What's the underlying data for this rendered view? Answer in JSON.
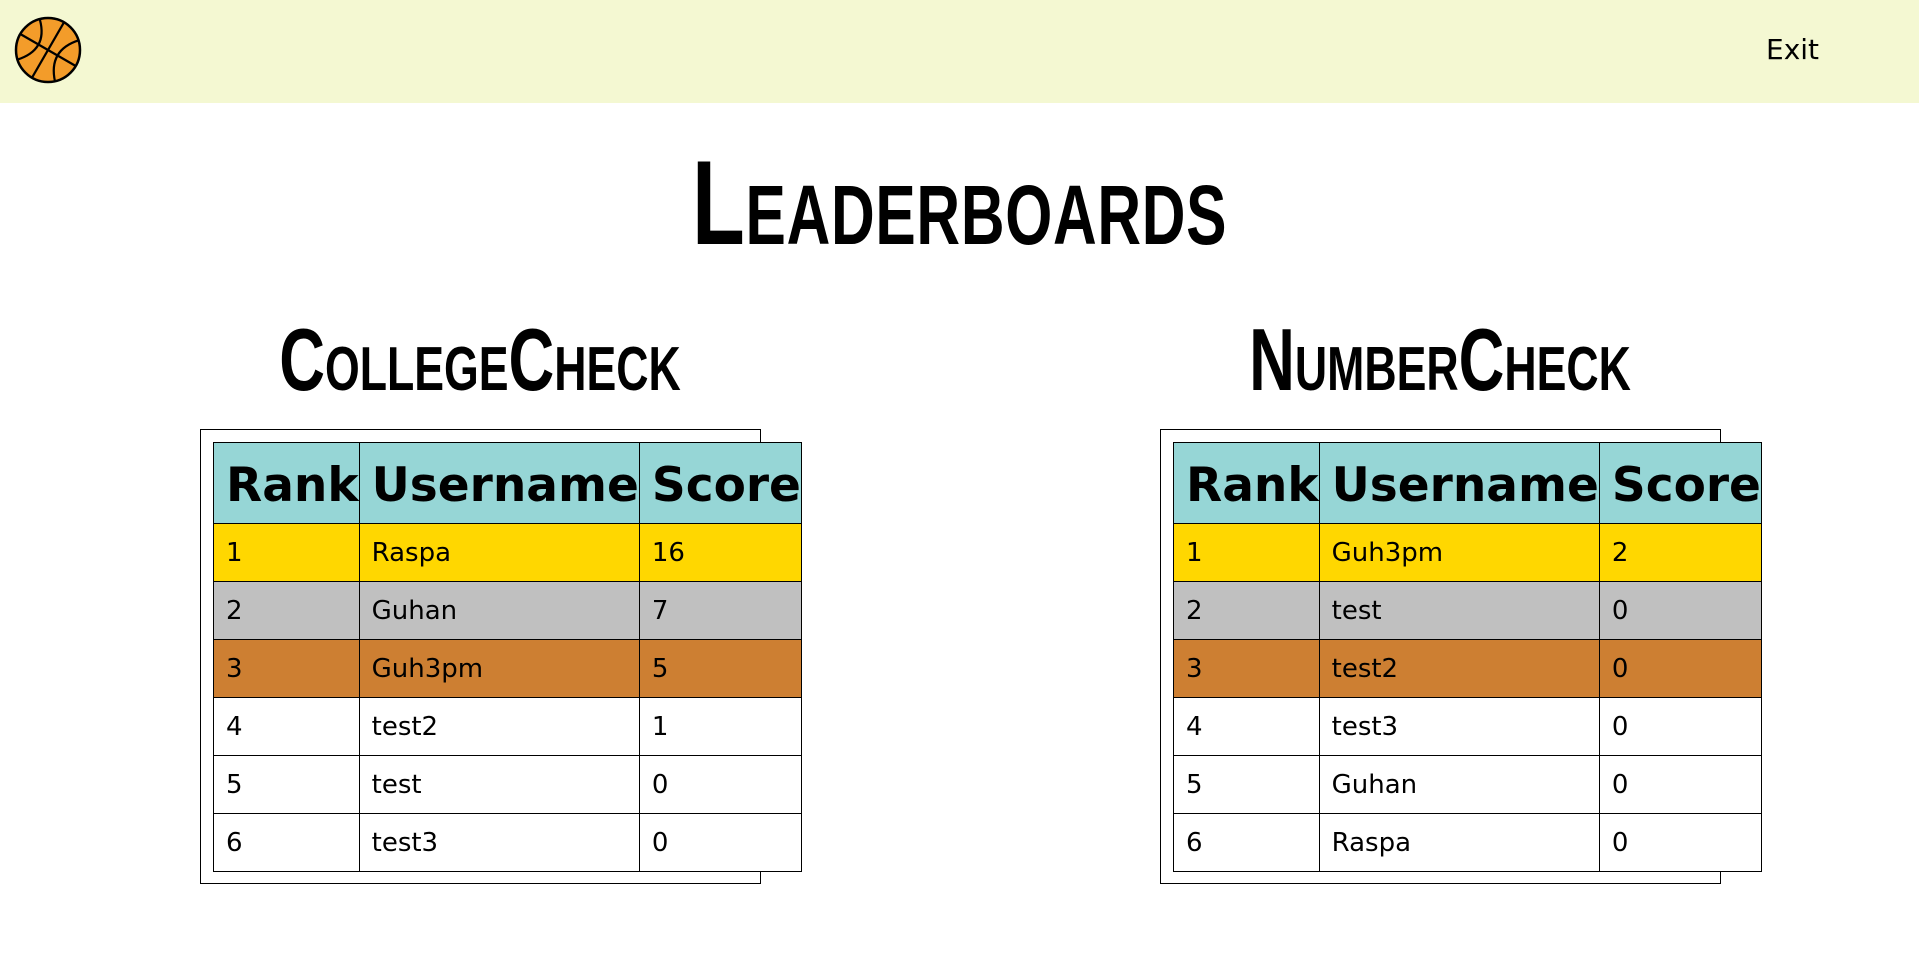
{
  "nav": {
    "logo_icon": "basketball-icon",
    "exit_label": "Exit",
    "background": "#f4f8d2"
  },
  "page": {
    "title": "Leaderboards"
  },
  "colors": {
    "header": "#96d6d6",
    "gold": "#ffd700",
    "silver": "#c0c0c0",
    "bronze": "#cd7f32"
  },
  "boards": [
    {
      "title": "CollegeCheck",
      "headers": [
        "Rank",
        "Username",
        "Score"
      ],
      "rows": [
        [
          "1",
          "Raspa",
          "16"
        ],
        [
          "2",
          "Guhan",
          "7"
        ],
        [
          "3",
          "Guh3pm",
          "5"
        ],
        [
          "4",
          "test2",
          "1"
        ],
        [
          "5",
          "test",
          "0"
        ],
        [
          "6",
          "test3",
          "0"
        ]
      ]
    },
    {
      "title": "NumberCheck",
      "headers": [
        "Rank",
        "Username",
        "Score"
      ],
      "rows": [
        [
          "1",
          "Guh3pm",
          "2"
        ],
        [
          "2",
          "test",
          "0"
        ],
        [
          "3",
          "test2",
          "0"
        ],
        [
          "4",
          "test3",
          "0"
        ],
        [
          "5",
          "Guhan",
          "0"
        ],
        [
          "6",
          "Raspa",
          "0"
        ]
      ]
    }
  ]
}
